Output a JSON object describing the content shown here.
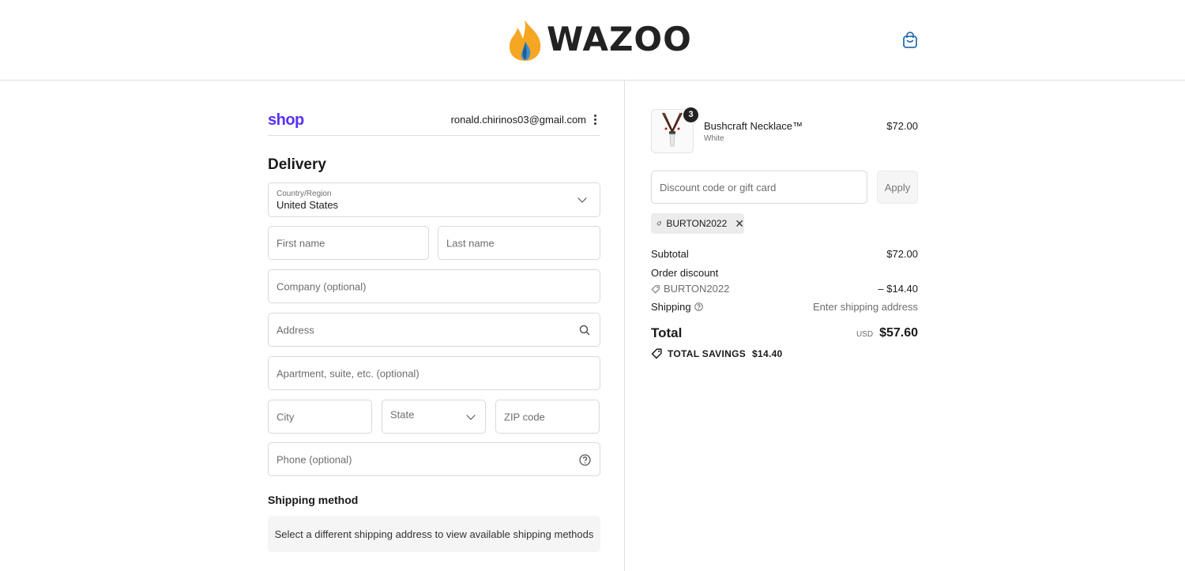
{
  "header": {
    "brand": "WAZOO",
    "cart_icon": "shopping-bag-icon"
  },
  "account": {
    "shop_label": "shop",
    "email": "ronald.chirinos03@gmail.com",
    "menu_icon": "kebab-menu-icon"
  },
  "delivery": {
    "title": "Delivery",
    "country_label": "Country/Region",
    "country_value": "United States",
    "first_name_placeholder": "First name",
    "last_name_placeholder": "Last name",
    "company_placeholder": "Company (optional)",
    "address_placeholder": "Address",
    "apartment_placeholder": "Apartment, suite, etc. (optional)",
    "city_placeholder": "City",
    "state_placeholder": "State",
    "zip_placeholder": "ZIP code",
    "phone_placeholder": "Phone (optional)"
  },
  "shipping_method": {
    "title": "Shipping method",
    "notice": "Select a different shipping address to view available shipping methods"
  },
  "cart": {
    "item": {
      "name": "Bushcraft Necklace™",
      "variant": "White",
      "price": "$72.00",
      "quantity": "3"
    },
    "discount_placeholder": "Discount code or gift card",
    "apply_label": "Apply",
    "applied_code": "BURTON2022"
  },
  "summary": {
    "subtotal_label": "Subtotal",
    "subtotal_value": "$72.00",
    "order_discount_label": "Order discount",
    "discount_code": "BURTON2022",
    "discount_value": "– $14.40",
    "shipping_label": "Shipping",
    "shipping_value": "Enter shipping address",
    "total_label": "Total",
    "currency": "USD",
    "total_value": "$57.60",
    "savings_label": "TOTAL SAVINGS",
    "savings_value": "$14.40"
  },
  "colors": {
    "flame_orange": "#f5a623",
    "flame_blue": "#3a8fd1",
    "shop_purple": "#5a31f4",
    "cart_icon": "#2a6fb0"
  }
}
